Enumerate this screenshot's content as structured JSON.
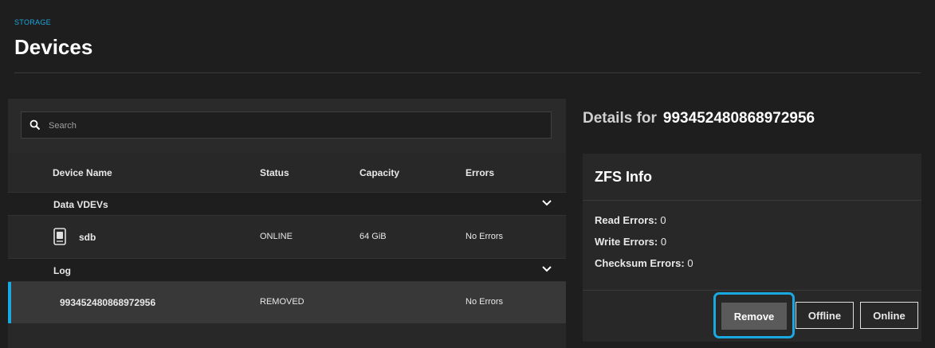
{
  "header": {
    "breadcrumb": "STORAGE",
    "title": "Devices"
  },
  "search": {
    "placeholder": "Search",
    "value": ""
  },
  "table": {
    "columns": [
      "Device Name",
      "Status",
      "Capacity",
      "Errors"
    ],
    "groups": [
      {
        "label": "Data VDEVs",
        "rows": [
          {
            "name": "sdb",
            "status": "ONLINE",
            "capacity": "64 GiB",
            "errors": "No Errors",
            "icon": "disk-icon"
          }
        ]
      },
      {
        "label": "Log",
        "rows": [
          {
            "name": "993452480868972956",
            "status": "REMOVED",
            "capacity": "",
            "errors": "No Errors",
            "selected": true
          }
        ]
      }
    ]
  },
  "details": {
    "prefix": "Details for",
    "device": "993452480868972956",
    "card_title": "ZFS Info",
    "read_errors_label": "Read Errors:",
    "read_errors": "0",
    "write_errors_label": "Write Errors:",
    "write_errors": "0",
    "checksum_errors_label": "Checksum Errors:",
    "checksum_errors": "0",
    "buttons": {
      "remove": "Remove",
      "offline": "Offline",
      "online": "Online"
    }
  },
  "colors": {
    "accent": "#1aa8e0",
    "background": "#1e1e1e",
    "panel": "#282828"
  }
}
